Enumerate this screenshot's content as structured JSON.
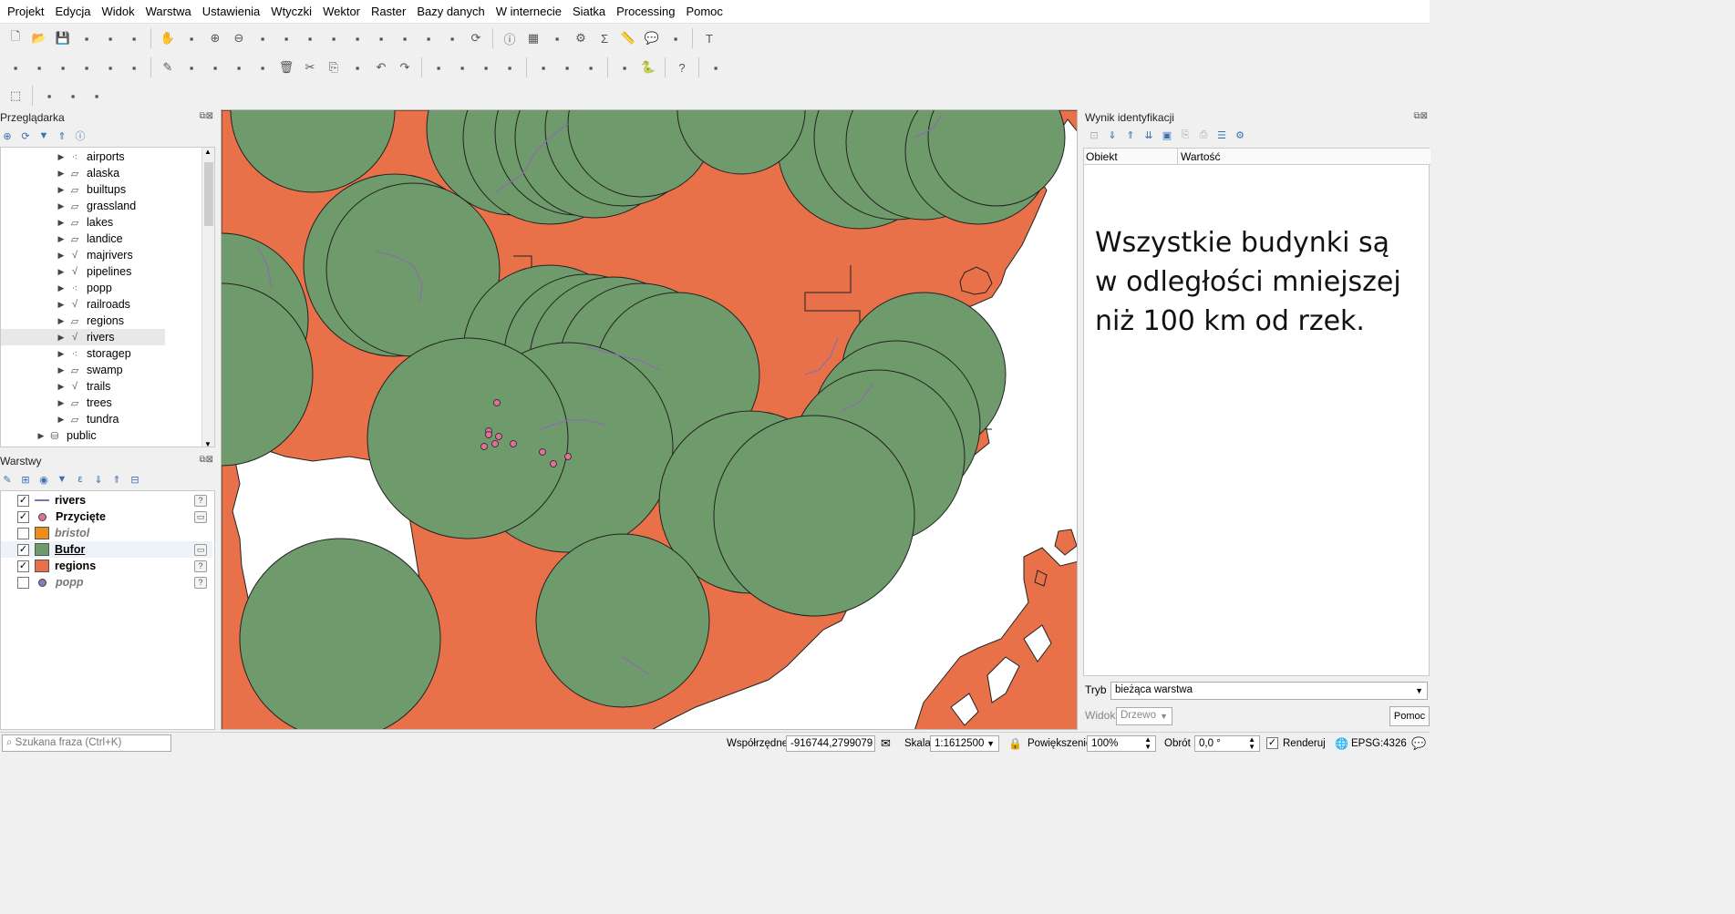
{
  "menu": [
    "Projekt",
    "Edycja",
    "Widok",
    "Warstwa",
    "Ustawienia",
    "Wtyczki",
    "Wektor",
    "Raster",
    "Bazy danych",
    "W internecie",
    "Siatka",
    "Processing",
    "Pomoc"
  ],
  "browser": {
    "title": "Przeglądarka",
    "items": [
      {
        "label": "airports",
        "type": "point"
      },
      {
        "label": "alaska",
        "type": "polygon"
      },
      {
        "label": "builtups",
        "type": "polygon"
      },
      {
        "label": "grassland",
        "type": "polygon"
      },
      {
        "label": "lakes",
        "type": "polygon"
      },
      {
        "label": "landice",
        "type": "polygon"
      },
      {
        "label": "majrivers",
        "type": "line"
      },
      {
        "label": "pipelines",
        "type": "line"
      },
      {
        "label": "popp",
        "type": "point"
      },
      {
        "label": "railroads",
        "type": "line"
      },
      {
        "label": "regions",
        "type": "polygon"
      },
      {
        "label": "rivers",
        "type": "line"
      },
      {
        "label": "storagep",
        "type": "point"
      },
      {
        "label": "swamp",
        "type": "polygon"
      },
      {
        "label": "trails",
        "type": "line"
      },
      {
        "label": "trees",
        "type": "polygon"
      },
      {
        "label": "tundra",
        "type": "polygon"
      }
    ],
    "schema": "public",
    "selected": "rivers"
  },
  "layers": {
    "title": "Warstwy",
    "items": [
      {
        "label": "rivers",
        "checked": true,
        "symbol": "line",
        "color": "#8a6fa8",
        "italic": false,
        "badge": "?"
      },
      {
        "label": "Przycięte",
        "checked": true,
        "symbol": "point",
        "color": "#e0709a",
        "italic": false,
        "badge": "▭"
      },
      {
        "label": "bristol",
        "checked": false,
        "symbol": "fill",
        "color": "#f08c1c",
        "italic": true,
        "badge": ""
      },
      {
        "label": "Bufor",
        "checked": true,
        "symbol": "fill",
        "color": "#6f9a6b",
        "italic": false,
        "badge": "▭",
        "underline": true
      },
      {
        "label": "regions",
        "checked": true,
        "symbol": "fill",
        "color": "#e8714a",
        "italic": false,
        "badge": "?"
      },
      {
        "label": "popp",
        "checked": false,
        "symbol": "point",
        "color": "#8c7ab8",
        "italic": true,
        "badge": "?"
      }
    ]
  },
  "identify": {
    "title": "Wynik identyfikacji",
    "col_object": "Obiekt",
    "col_value": "Wartość",
    "note": "Wszystkie budynki są w odległości mniejszej niż 100 km od rzek.",
    "mode_label": "Tryb",
    "mode_value": "bieżąca warstwa",
    "view_label": "Widok",
    "view_value": "Drzewo",
    "help": "Pomoc"
  },
  "status": {
    "search_placeholder": "Szukana fraza (Ctrl+K)",
    "coord_label": "Współrzędne",
    "coord_value": "-916744,2799079",
    "scale_label": "Skala",
    "scale_value": "1:1612500",
    "zoom_label": "Powiększenie",
    "zoom_value": "100%",
    "rotation_label": "Obrót",
    "rotation_value": "0,0 °",
    "render_label": "Renderuj",
    "crs": "EPSG:4326"
  },
  "colors": {
    "land": "#e8714a",
    "buffer": "#6f9a6b",
    "river": "#8a6fa8",
    "point": "#e0709a",
    "water": "#ffffff"
  }
}
